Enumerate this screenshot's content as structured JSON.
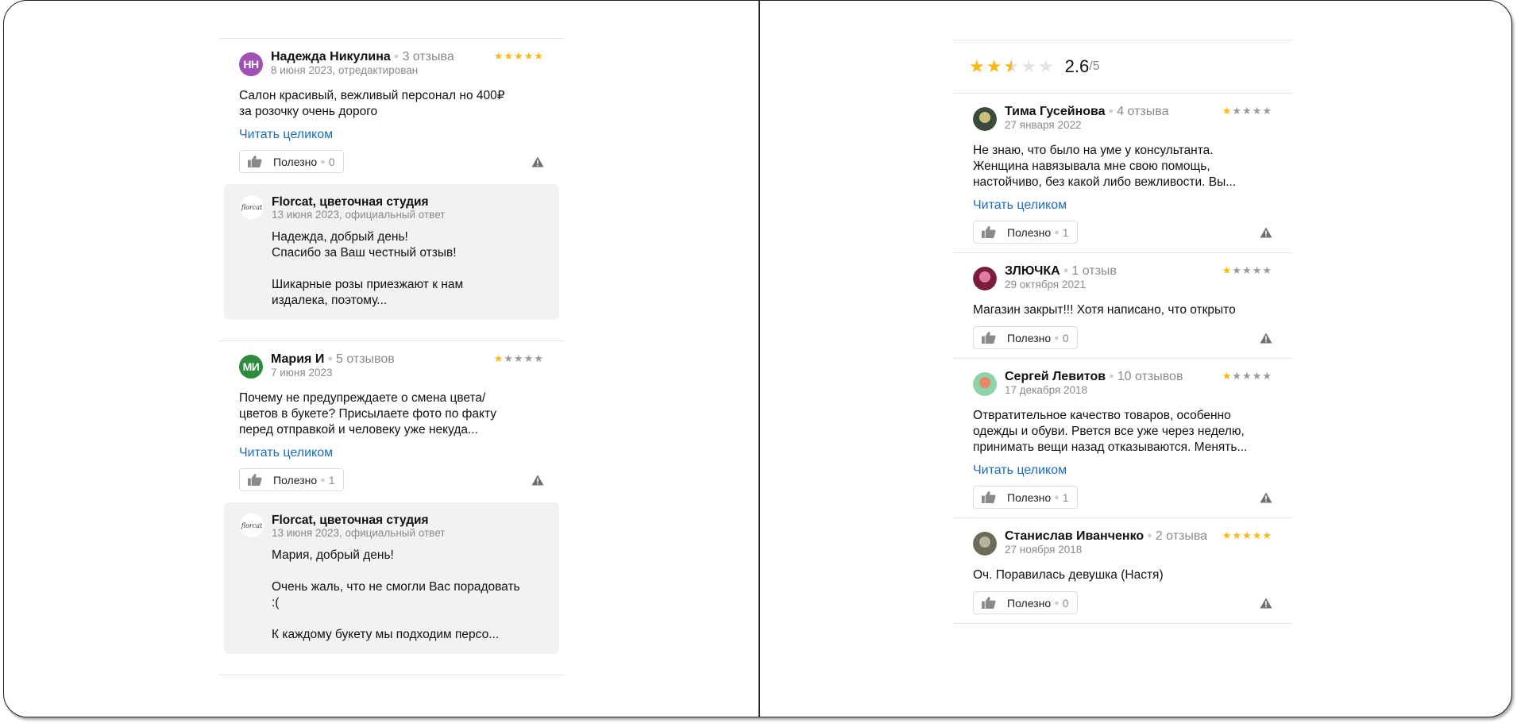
{
  "left": {
    "reviews": [
      {
        "avatar_initials": "НН",
        "avatar_color": "#a051b3",
        "author": "Надежда Никулина",
        "count": "3 отзыва",
        "date": "8 июня 2023, отредактирован",
        "rating": 5,
        "text": "Салон красивый, вежливый персонал но 400₽\nза розочку очень дорого",
        "read_more": "Читать целиком",
        "useful_label": "Полезно",
        "useful_count": "0",
        "reply": {
          "logo_text": "florcat",
          "name": "Florcat, цветочная студия",
          "date": "13 июня 2023, официальный ответ",
          "text": "Надежда, добрый день!\nСпасибо за Ваш честный отзыв!\n\nШикарные розы приезжают к нам\nиздалека, поэтому..."
        }
      },
      {
        "avatar_initials": "МИ",
        "avatar_color": "#2e8b3d",
        "author": "Мария И",
        "count": "5 отзывов",
        "date": "7 июня 2023",
        "rating": 1,
        "text": "Почему не предупреждаете о смена цвета/\nцветов в букете? Присылаете фото по факту\nперед отправкой и человеку уже некуда...",
        "read_more": "Читать целиком",
        "useful_label": "Полезно",
        "useful_count": "1",
        "reply": {
          "logo_text": "florcat",
          "name": "Florcat, цветочная студия",
          "date": "13 июня 2023, официальный ответ",
          "text": "Мария, добрый день!\n\nОчень жаль, что не смогли Вас порадовать\n:(\n\nК каждому букету мы подходим персо..."
        }
      }
    ]
  },
  "right": {
    "summary": {
      "rating": 2.6,
      "value": "2.6",
      "max": "/5"
    },
    "reviews": [
      {
        "author": "Тима Гусейнова",
        "count": "4 отзыва",
        "date": "27 января 2022",
        "rating": 1,
        "avatar_colors": [
          "#3a4a3c",
          "#c9c27a"
        ],
        "text": "Не знаю, что было на уме у консультанта.\nЖенщина навязывала мне свою помощь,\nнастойчиво, без какой либо вежливости. Вы...",
        "read_more": "Читать целиком",
        "useful_label": "Полезно",
        "useful_count": "1"
      },
      {
        "author": "ЗЛЮЧКА",
        "count": "1 отзыв",
        "date": "29 октября 2021",
        "rating": 1,
        "avatar_colors": [
          "#7a1d3a",
          "#e07aa0"
        ],
        "text": "Магазин закрыт!!! Хотя написано, что открыто",
        "read_more": "",
        "useful_label": "Полезно",
        "useful_count": "0"
      },
      {
        "author": "Сергей Левитов",
        "count": "10 отзывов",
        "date": "17 декабря 2018",
        "rating": 1,
        "avatar_colors": [
          "#8fd4a8",
          "#e8876a"
        ],
        "text": "Отвратительное качество товаров, особенно\nодежды и обуви. Рвется все уже через неделю,\nпринимать вещи назад отказываются. Менять...",
        "read_more": "Читать целиком",
        "useful_label": "Полезно",
        "useful_count": "1"
      },
      {
        "author": "Станислав Иванченко",
        "count": "2 отзыва",
        "date": "27 ноября 2018",
        "rating": 5,
        "avatar_colors": [
          "#6b6b5a",
          "#b8b39a"
        ],
        "text": "Оч. Поравилась девушка (Настя)",
        "read_more": "",
        "useful_label": "Полезно",
        "useful_count": "0"
      }
    ]
  },
  "colors": {
    "star": "#fcb913",
    "link": "#1a6dbf",
    "muted": "#8a8a8a"
  },
  "icons": {
    "useful": "thumbs-up-icon",
    "report": "warning-icon",
    "star": "star-icon"
  }
}
